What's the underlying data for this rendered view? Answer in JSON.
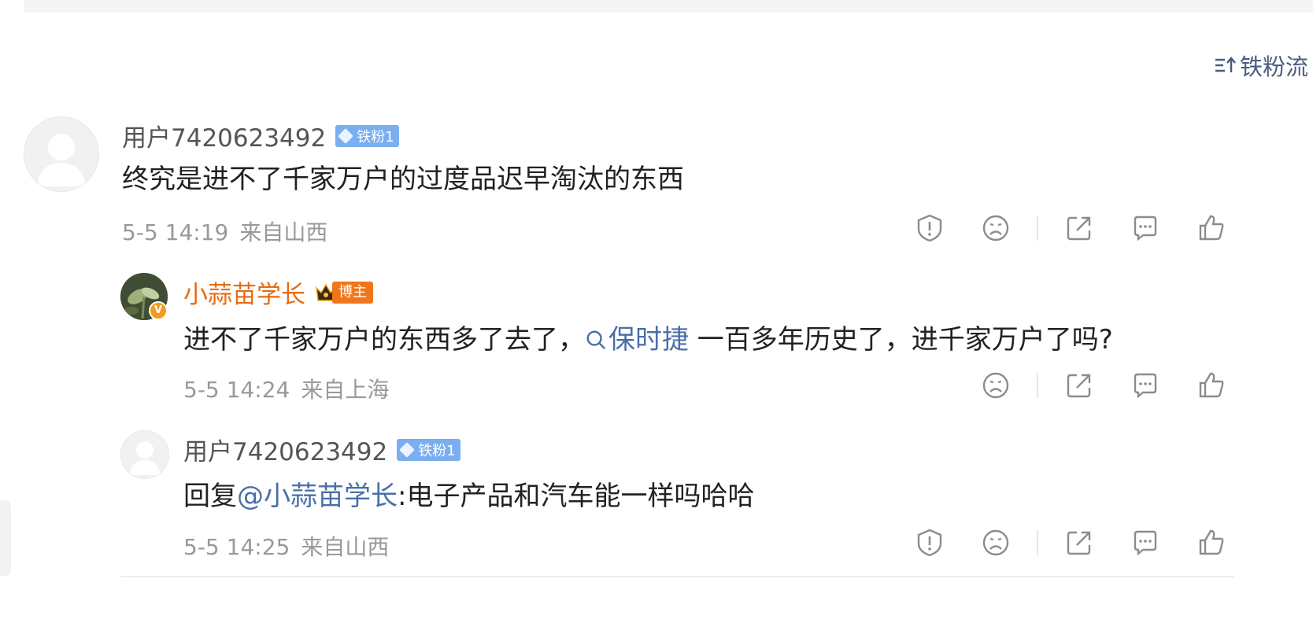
{
  "sort": {
    "label": "铁粉流"
  },
  "comments": [
    {
      "user": "用户7420623492",
      "badge": "铁粉1",
      "text": "终究是进不了千家万户的过度品迟早淘汰的东西",
      "time": "5-5 14:19",
      "location": "来自山西"
    },
    {
      "user": "小蒜苗学长",
      "badge": "博主",
      "text_before": "进不了千家万户的东西多了去了，",
      "link": "保时捷",
      "text_after": " 一百多年历史了，进千家万户了吗?",
      "time": "5-5 14:24",
      "location": "来自上海",
      "verified": "V"
    },
    {
      "user": "用户7420623492",
      "badge": "铁粉1",
      "reply_prefix": "回复",
      "mention": "@小蒜苗学长",
      "text_after": ":电子产品和汽车能一样吗哈哈",
      "time": "5-5 14:25",
      "location": "来自山西"
    }
  ],
  "icons": [
    "sort-icon",
    "report-icon",
    "dislike-icon",
    "share-icon",
    "reply-icon",
    "like-icon",
    "search-link-icon",
    "crown-icon",
    "diamond-icon"
  ],
  "colors": {
    "link": "#4a6ea9",
    "blogger_name": "#e86b12",
    "fan_badge": "#7aaef0",
    "blogger_badge": "#f0761e",
    "meta": "#999999",
    "icon": "#8c8c8c"
  }
}
